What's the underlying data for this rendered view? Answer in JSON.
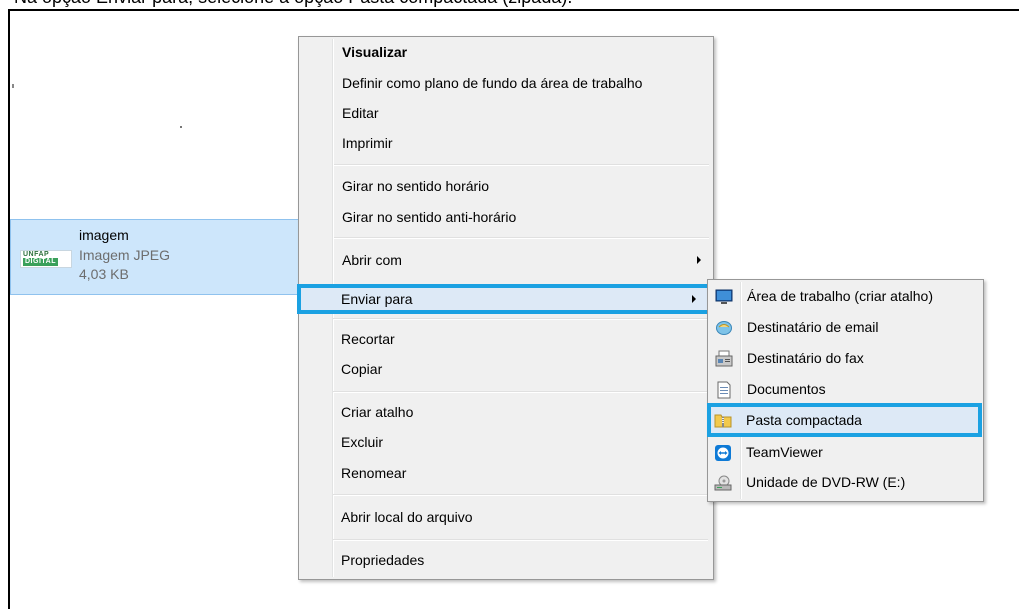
{
  "caption": "Na opção Enviar para, selecione a opção Pasta compactada (zipada).",
  "file": {
    "thumbnail_line1": "UNFAP",
    "thumbnail_line2": "DIGITAL",
    "name": "imagem",
    "type": "Imagem JPEG",
    "size": "4,03 KB"
  },
  "context_menu": {
    "items": [
      {
        "label": "Visualizar",
        "bold": true
      },
      {
        "label": "Definir como plano de fundo da área de trabalho"
      },
      {
        "label": "Editar"
      },
      {
        "label": "Imprimir"
      },
      {
        "label": "Girar no sentido horário"
      },
      {
        "label": "Girar no sentido anti-horário"
      },
      {
        "label": "Abrir com",
        "submenu": true
      },
      {
        "label": "Enviar para",
        "submenu": true,
        "highlighted": true
      },
      {
        "label": "Recortar"
      },
      {
        "label": "Copiar"
      },
      {
        "label": "Criar atalho"
      },
      {
        "label": "Excluir"
      },
      {
        "label": "Renomear"
      },
      {
        "label": "Abrir local do arquivo"
      },
      {
        "label": "Propriedades"
      }
    ]
  },
  "send_to_submenu": {
    "items": [
      {
        "label": "Área de trabalho (criar atalho)",
        "icon": "desktop-icon"
      },
      {
        "label": "Destinatário de email",
        "icon": "mail-recipient-icon"
      },
      {
        "label": "Destinatário do fax",
        "icon": "fax-icon"
      },
      {
        "label": "Documentos",
        "icon": "documents-icon"
      },
      {
        "label": "Pasta compactada",
        "icon": "zip-folder-icon",
        "highlighted": true
      },
      {
        "label": "TeamViewer",
        "icon": "teamviewer-icon"
      },
      {
        "label": "Unidade de DVD-RW (E:)",
        "icon": "dvd-drive-icon"
      }
    ]
  },
  "colors": {
    "highlight_border": "#1ba1e2",
    "selection_fill": "#cde6fb",
    "menu_background": "#f0f0f0"
  }
}
